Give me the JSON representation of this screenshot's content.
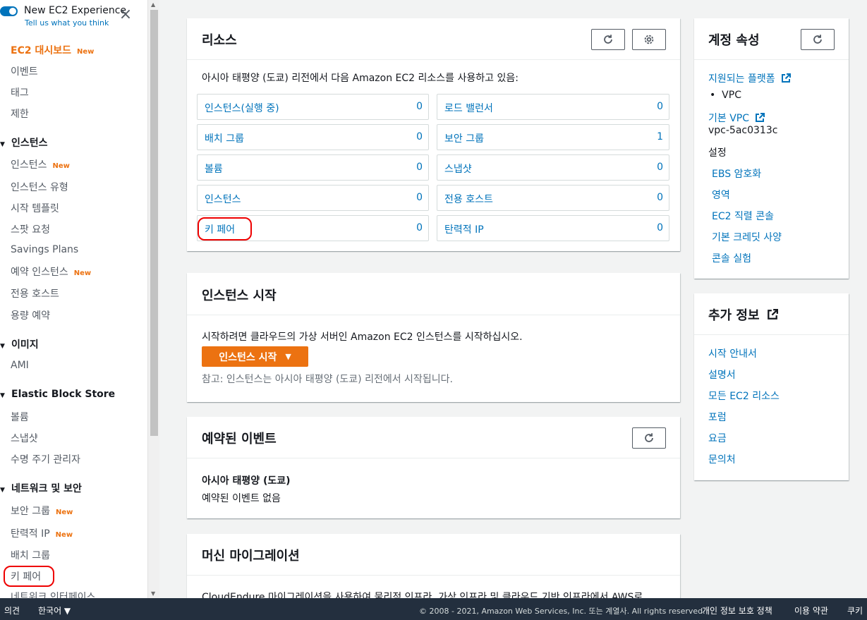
{
  "sidebar": {
    "toggle_title": "New EC2 Experience",
    "toggle_sub": "Tell us what you think",
    "close_glyph": "×",
    "new_label": "New",
    "dashboard": "EC2 대시보드",
    "items_top": [
      "이벤트",
      "태그",
      "제한"
    ],
    "sec_instances": "인스턴스",
    "instances": [
      "인스턴스",
      "인스턴스 유형",
      "시작 템플릿",
      "스팟 요청",
      "Savings Plans",
      "예약 인스턴스",
      "전용 호스트",
      "용량 예약"
    ],
    "sec_images": "이미지",
    "images": [
      "AMI"
    ],
    "sec_ebs": "Elastic Block Store",
    "ebs": [
      "볼륨",
      "스냅샷",
      "수명 주기 관리자"
    ],
    "sec_network": "네트워크 및 보안",
    "network": [
      "보안 그룹",
      "탄력적 IP",
      "배치 그룹",
      "키 페어",
      "네트워크 인터페이스"
    ]
  },
  "resources": {
    "title": "리소스",
    "desc": "아시아 태평양 (도쿄) 리전에서 다음 Amazon EC2 리소스를 사용하고 있음:",
    "cells": [
      {
        "label": "인스턴스(실행 중)",
        "count": "0"
      },
      {
        "label": "로드 밸런서",
        "count": "0"
      },
      {
        "label": "배치 그룹",
        "count": "0"
      },
      {
        "label": "보안 그룹",
        "count": "1"
      },
      {
        "label": "볼륨",
        "count": "0"
      },
      {
        "label": "스냅샷",
        "count": "0"
      },
      {
        "label": "인스턴스",
        "count": "0"
      },
      {
        "label": "전용 호스트",
        "count": "0"
      },
      {
        "label": "키 페어",
        "count": "0"
      },
      {
        "label": "탄력적 IP",
        "count": "0"
      }
    ]
  },
  "launch": {
    "title": "인스턴스 시작",
    "desc": "시작하려면 클라우드의 가상 서버인 Amazon EC2 인스턴스를 시작하십시오.",
    "button": "인스턴스 시작",
    "caret": "▼",
    "note": "참고: 인스턴스는 아시아 태평양 (도쿄) 리전에서 시작됩니다."
  },
  "events": {
    "title": "예약된 이벤트",
    "region": "아시아 태평양 (도쿄)",
    "none": "예약된 이벤트 없음"
  },
  "migration": {
    "title": "머신 마이그레이션",
    "desc": "CloudEndure 마이그레이션을 사용하여 물리적 인프라, 가상 인프라 및 클라우드 기반 인프라에서 AWS로"
  },
  "account": {
    "title": "계정 속성",
    "platforms": "지원되는 플랫폼",
    "vpc_bullet": "VPC",
    "default_vpc": "기본 VPC",
    "vpc_id": "vpc-5ac0313c",
    "settings": "설정",
    "links": [
      "EBS 암호화",
      "영역",
      "EC2 직렬 콘솔",
      "기본 크레딧 사양",
      "콘솔 실험"
    ]
  },
  "more": {
    "title": "추가 정보",
    "links": [
      "시작 안내서",
      "설명서",
      "모든 EC2 리소스",
      "포럼",
      "요금",
      "문의처"
    ]
  },
  "footer": {
    "feedback": "의견",
    "language": "한국어 ▼",
    "copyright": "© 2008 - 2021, Amazon Web Services, Inc. 또는 계열사. All rights reserved.",
    "privacy": "개인 정보 보호 정책",
    "terms": "이용 약관",
    "cookies": "쿠키"
  },
  "colors": {
    "accent": "#ec7211",
    "link": "#0073bb",
    "footer_bg": "#232f3e"
  }
}
